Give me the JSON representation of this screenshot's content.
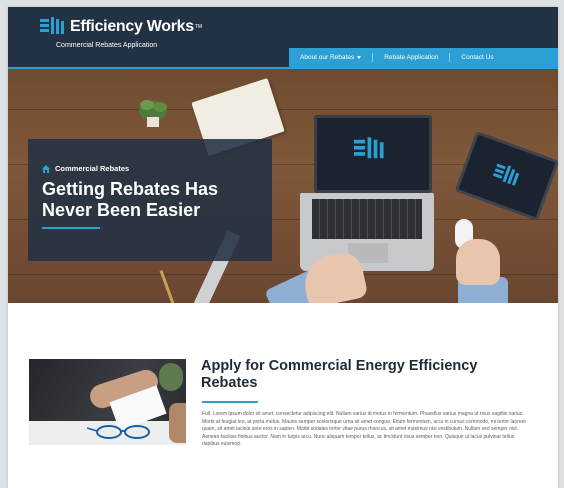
{
  "header": {
    "brand_name": "Efficiency Works",
    "brand_mark": "TM",
    "brand_subtitle": "Commercial Rebates Application",
    "nav": [
      {
        "label": "About our Rebates",
        "has_dropdown": true
      },
      {
        "label": "Rebate Application",
        "has_dropdown": false
      },
      {
        "label": "Contact Us",
        "has_dropdown": false
      }
    ]
  },
  "hero": {
    "category": "Commercial Rebates",
    "category_icon": "home-icon",
    "title": "Getting Rebates Has Never Been Easier"
  },
  "content": {
    "title": "Apply for Commercial Energy Efficiency Rebates",
    "body": "Full. Lorem ipsum dolor sit amet, consectetur adipiscing elit. Nullam varius id metus in fermentum. Phasellus varius magna ut risus sagittis varius. Morbi at feugiat leo, at porta metus. Mauris semper scelerisque urna sit amet congue. Etiam fermentum, arcu in cursus commodo, mi tortor laoreet quam, sit amet lacinia ante eros in sapien. Morbi sodales tortor vitae purus rhoncus, sit amet maximus nisi vestibulum. Nullam sed semper nisl. Aenean facilisis finibus auctor. Nam in turpis arcu. Nunc aliquam tempor tellus, ac tincidunt risus semper non. Quisque ut lacus pulvinar tellus dapibus euismod."
  },
  "colors": {
    "navy": "#223143",
    "accent_blue": "#2c9fd4",
    "white": "#ffffff"
  }
}
